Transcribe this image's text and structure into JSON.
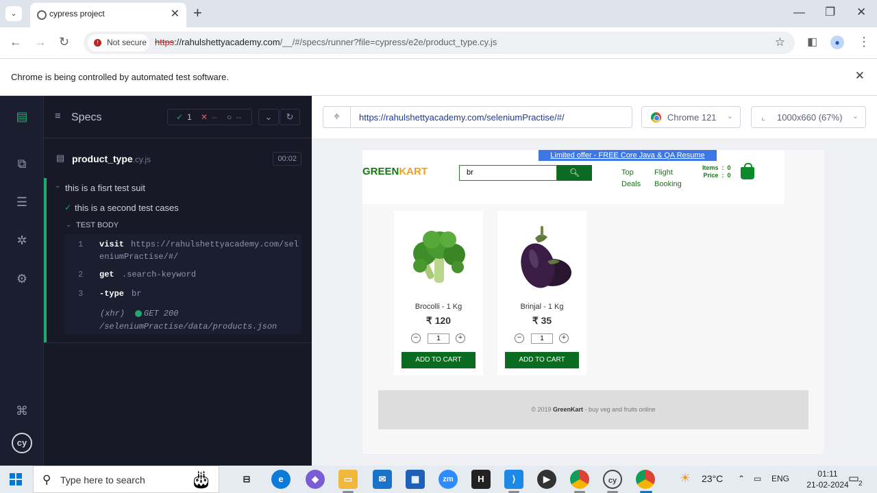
{
  "browser": {
    "tab_title": "cypress project",
    "not_secure": "Not secure",
    "url_scheme": "https",
    "url_host": "://rahulshettyacademy.com",
    "url_path": "/__/#/specs/runner?file=cypress/e2e/product_type.cy.js",
    "automation_notice": "Chrome is being controlled by automated test software."
  },
  "reporter": {
    "specs_label": "Specs",
    "passed": "1",
    "failed": "--",
    "pending": "--",
    "spec_name": "product_type",
    "spec_ext": ".cy.js",
    "duration": "00:02",
    "suite_title": "this is a fisrt test suit",
    "test_title": "this is a second test cases",
    "test_body_label": "TEST BODY",
    "commands": [
      {
        "num": "1",
        "name": "visit",
        "arg": "https://rahulshettyacademy.com/sel",
        "arg2": "eniumPractise/#/"
      },
      {
        "num": "2",
        "name": "get",
        "arg": ".search-keyword"
      },
      {
        "num": "3",
        "name": "-type",
        "arg": "br"
      }
    ],
    "xhr": {
      "label": "(xhr)",
      "request": "GET 200",
      "path": "/seleniumPractise/data/products.json"
    }
  },
  "aut": {
    "url": "https://rahulshettyacademy.com/seleniumPractise/#/",
    "browser": "Chrome 121",
    "viewport": "1000x660 (67%)"
  },
  "site": {
    "promo": "Limited offer - FREE Core Java & QA Resume course",
    "logo_green": "GREEN",
    "logo_kart": "KART",
    "search_value": "br",
    "top_deals_1": "Top",
    "top_deals_2": "Deals",
    "flight_1": "Flight",
    "flight_2": "Booking",
    "items_label": "Items",
    "items_value": "0",
    "price_label": "Price",
    "price_value": "0",
    "products": [
      {
        "name": "Brocolli - 1 Kg",
        "price": "₹ 120",
        "qty": "1",
        "cta": "ADD TO CART"
      },
      {
        "name": "Brinjal - 1 Kg",
        "price": "₹ 35",
        "qty": "1",
        "cta": "ADD TO CART"
      }
    ],
    "footer_pre": "© 2019",
    "footer_brand": "GreenKart",
    "footer_post": "- buy veg and fruits online"
  },
  "taskbar": {
    "search_placeholder": "Type here to search",
    "weather": "23°C",
    "lang": "ENG",
    "time": "01:11",
    "date": "21-02-2024",
    "notif_count": "2"
  },
  "colors": {
    "cypress_green": "#1fa971",
    "kart_green": "#0b6b20",
    "promo_blue": "#3d77e6"
  }
}
